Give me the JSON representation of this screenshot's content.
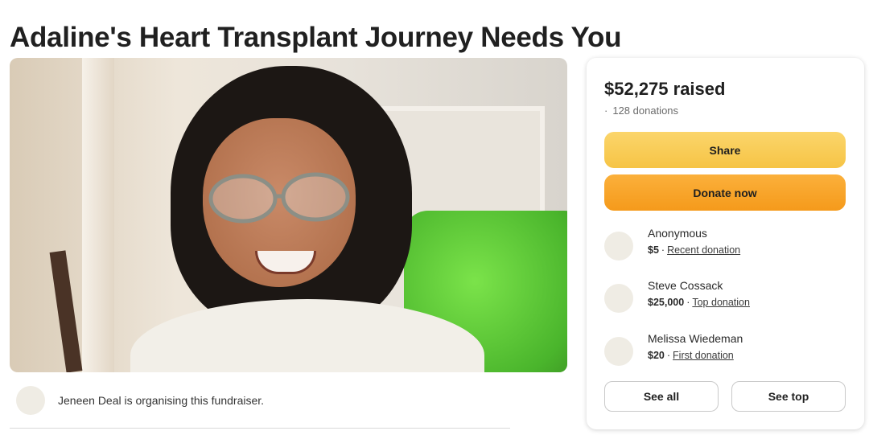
{
  "page": {
    "title": "Adaline's Heart Transplant Journey Needs You"
  },
  "organiser": {
    "text": "Jeneen Deal is organising this fundraiser."
  },
  "panel": {
    "raised": "$52,275 raised",
    "donations_dot": "·",
    "donations_count": "128 donations",
    "share_label": "Share",
    "donate_label": "Donate now",
    "donors": [
      {
        "name": "Anonymous",
        "amount": "$5",
        "sep": "·",
        "kind": "Recent donation"
      },
      {
        "name": "Steve Cossack",
        "amount": "$25,000",
        "sep": "·",
        "kind": "Top donation"
      },
      {
        "name": "Melissa Wiedeman",
        "amount": "$20",
        "sep": "·",
        "kind": "First donation"
      }
    ],
    "see_all_label": "See all",
    "see_top_label": "See top"
  },
  "colors": {
    "share_button": "#f6c445",
    "donate_button": "#f59a1b",
    "avatar_placeholder": "#efece4"
  },
  "icons": {
    "hero": "campaign-photo"
  }
}
